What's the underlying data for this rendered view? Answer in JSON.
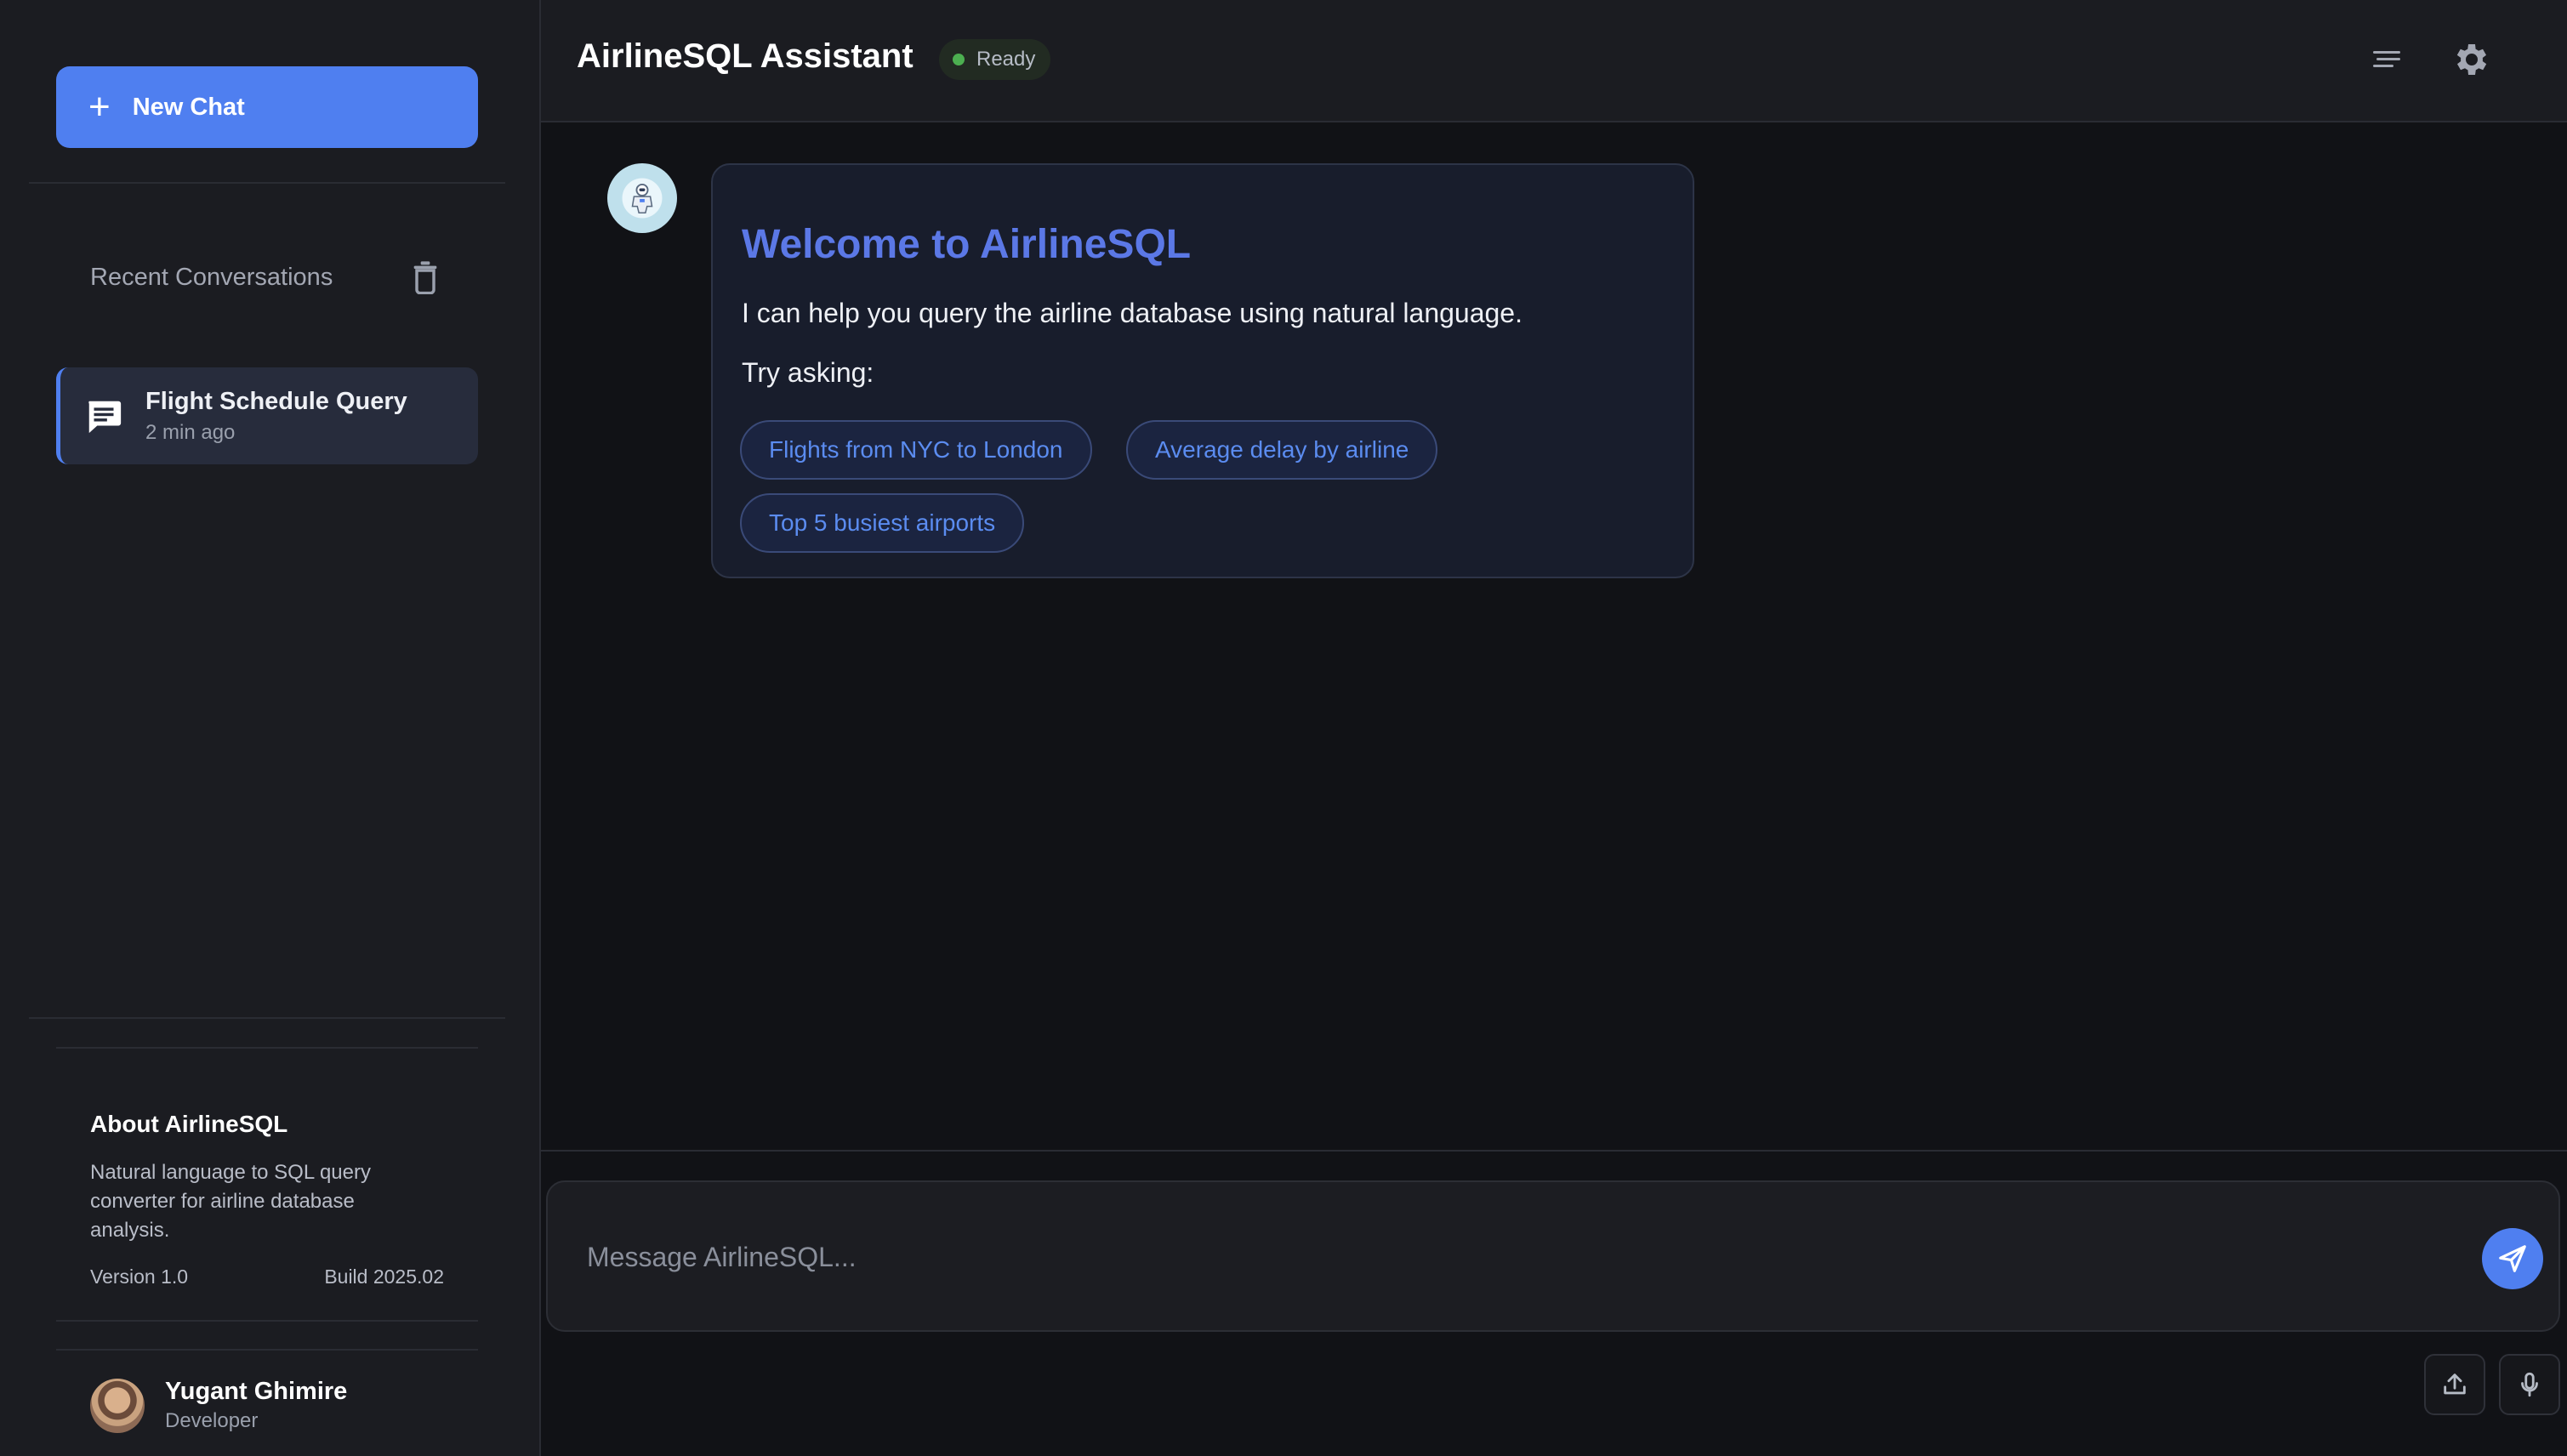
{
  "sidebar": {
    "new_chat_label": "New Chat",
    "recent_title": "Recent Conversations",
    "conversations": [
      {
        "title": "Flight Schedule Query",
        "time": "2 min ago"
      }
    ],
    "about": {
      "title": "About AirlineSQL",
      "description": "Natural language to SQL query converter for airline database analysis.",
      "version": "Version 1.0",
      "build": "Build 2025.02"
    },
    "user": {
      "name": "Yugant Ghimire",
      "role": "Developer"
    }
  },
  "header": {
    "title": "AirlineSQL Assistant",
    "status": "Ready"
  },
  "welcome": {
    "title": "Welcome to AirlineSQL",
    "text": "I can help you query the airline database using natural language.",
    "try_label": "Try asking:",
    "suggestions": [
      "Flights from NYC to London",
      "Average delay by airline",
      "Top 5 busiest airports"
    ]
  },
  "composer": {
    "placeholder": "Message AirlineSQL..."
  },
  "colors": {
    "accent": "#4f7ff0",
    "status_dot": "#4caf50",
    "sidebar_bg": "#1b1c21",
    "main_bg": "#111216"
  },
  "icons": {
    "new_chat": "plus-icon",
    "trash": "trash-icon",
    "conversation": "chat-bubble-icon",
    "menu": "menu-lines-icon",
    "settings": "gear-icon",
    "send": "send-icon",
    "upload": "upload-icon",
    "mic": "microphone-icon"
  }
}
